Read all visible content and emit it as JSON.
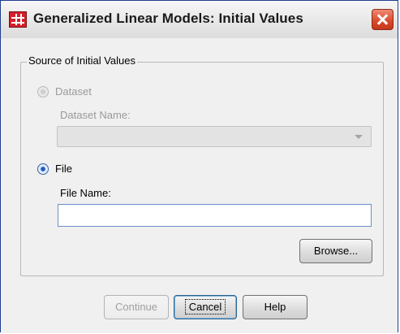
{
  "window": {
    "title": "Generalized Linear Models: Initial Values",
    "icon": "spss-table-icon",
    "close_icon": "close-icon"
  },
  "group": {
    "legend": "Source of Initial Values"
  },
  "dataset_option": {
    "label": "Dataset",
    "selected": false,
    "enabled": false,
    "name_label": "Dataset Name:",
    "name_value": ""
  },
  "file_option": {
    "label": "File",
    "selected": true,
    "enabled": true,
    "name_label": "File Name:",
    "name_value": ""
  },
  "buttons": {
    "browse": "Browse...",
    "continue": "Continue",
    "cancel": "Cancel",
    "help": "Help"
  },
  "colors": {
    "accent": "#1f57c3",
    "close": "#d9482a",
    "disabled_text": "#9a9a9a"
  }
}
